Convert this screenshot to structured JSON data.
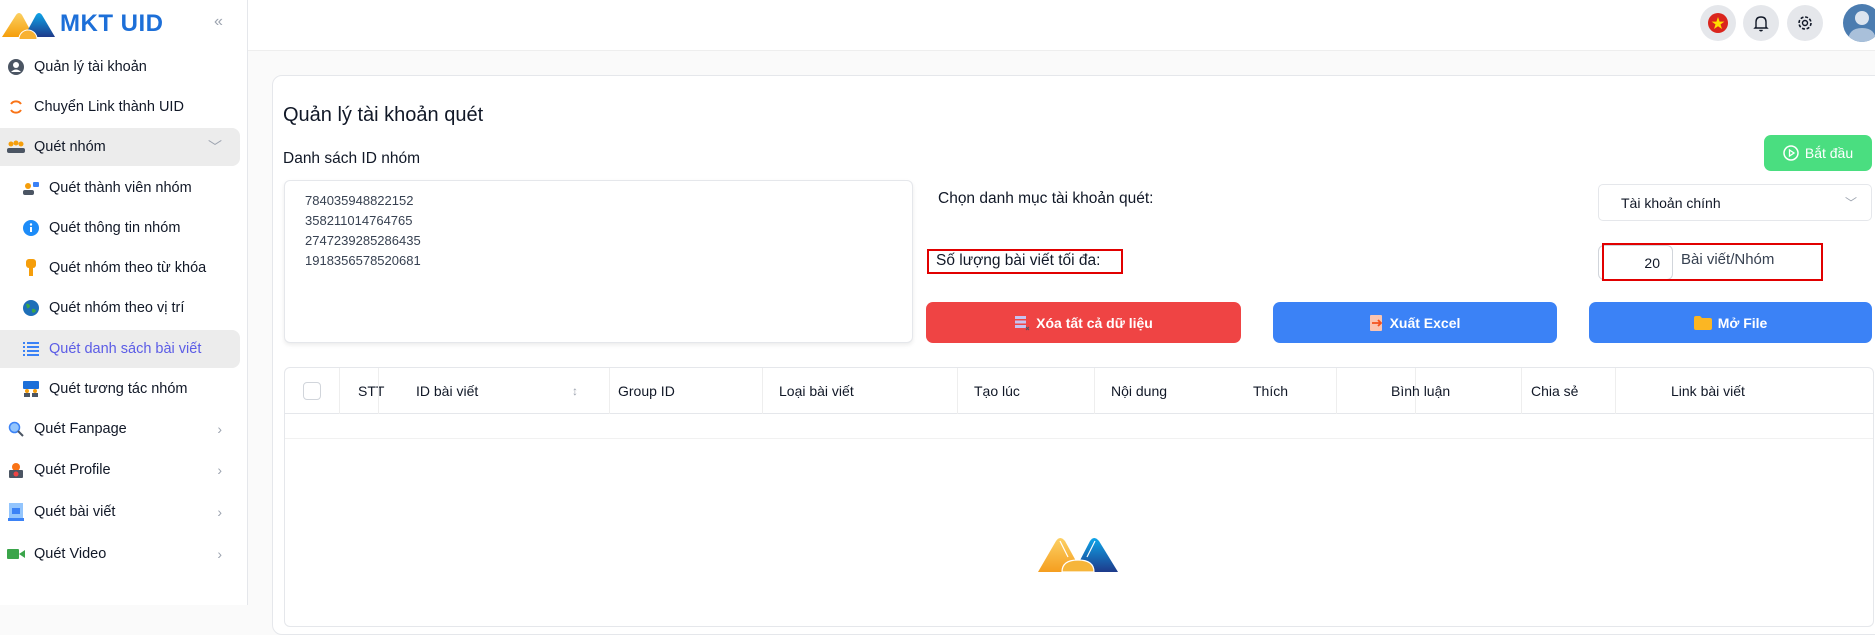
{
  "app": {
    "name": "MKT UID"
  },
  "sidebar": {
    "items": [
      {
        "label": "Quản lý tài khoản",
        "icon": "user-circle-icon"
      },
      {
        "label": "Chuyển Link thành UID",
        "icon": "refresh-icon"
      },
      {
        "label": "Quét nhóm",
        "icon": "group-icon",
        "expanded": true
      },
      {
        "label": "Quét thành viên nhóm",
        "icon": "members-icon"
      },
      {
        "label": "Quét thông tin nhóm",
        "icon": "info-icon"
      },
      {
        "label": "Quét nhóm theo từ khóa",
        "icon": "key-icon"
      },
      {
        "label": "Quét nhóm theo vị trí",
        "icon": "globe-icon"
      },
      {
        "label": "Quét danh sách bài viết",
        "icon": "list-icon",
        "active": true
      },
      {
        "label": "Quét tương tác nhóm",
        "icon": "interaction-icon"
      },
      {
        "label": "Quét Fanpage",
        "icon": "search-icon"
      },
      {
        "label": "Quét Profile",
        "icon": "profile-icon"
      },
      {
        "label": "Quét bài viết",
        "icon": "document-icon"
      },
      {
        "label": "Quét Video",
        "icon": "video-icon"
      }
    ]
  },
  "topbar": {
    "language": "vietnam-flag-icon",
    "notifications": "bell-icon",
    "settings": "gear-icon",
    "user": "avatar"
  },
  "main": {
    "title": "Quản lý tài khoản quét",
    "ids_label": "Danh sách ID nhóm",
    "group_ids": "784035948822152\n358211014764765\n2747239285286435\n1918356578520681",
    "start_button": "Bắt đầu",
    "category_label": "Chọn danh mục tài khoản quét:",
    "category_value": "Tài khoản chính",
    "max_posts_label": "Số lượng bài viết tối đa:",
    "max_posts_value": "20",
    "max_posts_unit": "Bài viết/Nhóm",
    "buttons": {
      "clear": "Xóa tất cả dữ liệu",
      "export": "Xuất Excel",
      "open": "Mở File"
    },
    "colors": {
      "start": "#4ade80",
      "clear": "#ef4444",
      "primary": "#3b82f6",
      "active_nav": "#5b5ce6",
      "highlight": "#e10000"
    }
  },
  "table": {
    "columns": [
      "STT",
      "ID bài viết",
      "Group ID",
      "Loại bài viết",
      "Tạo lúc",
      "Nội dung",
      "Thích",
      "Bình luận",
      "Chia sẻ",
      "Link bài viết"
    ],
    "rows": []
  }
}
